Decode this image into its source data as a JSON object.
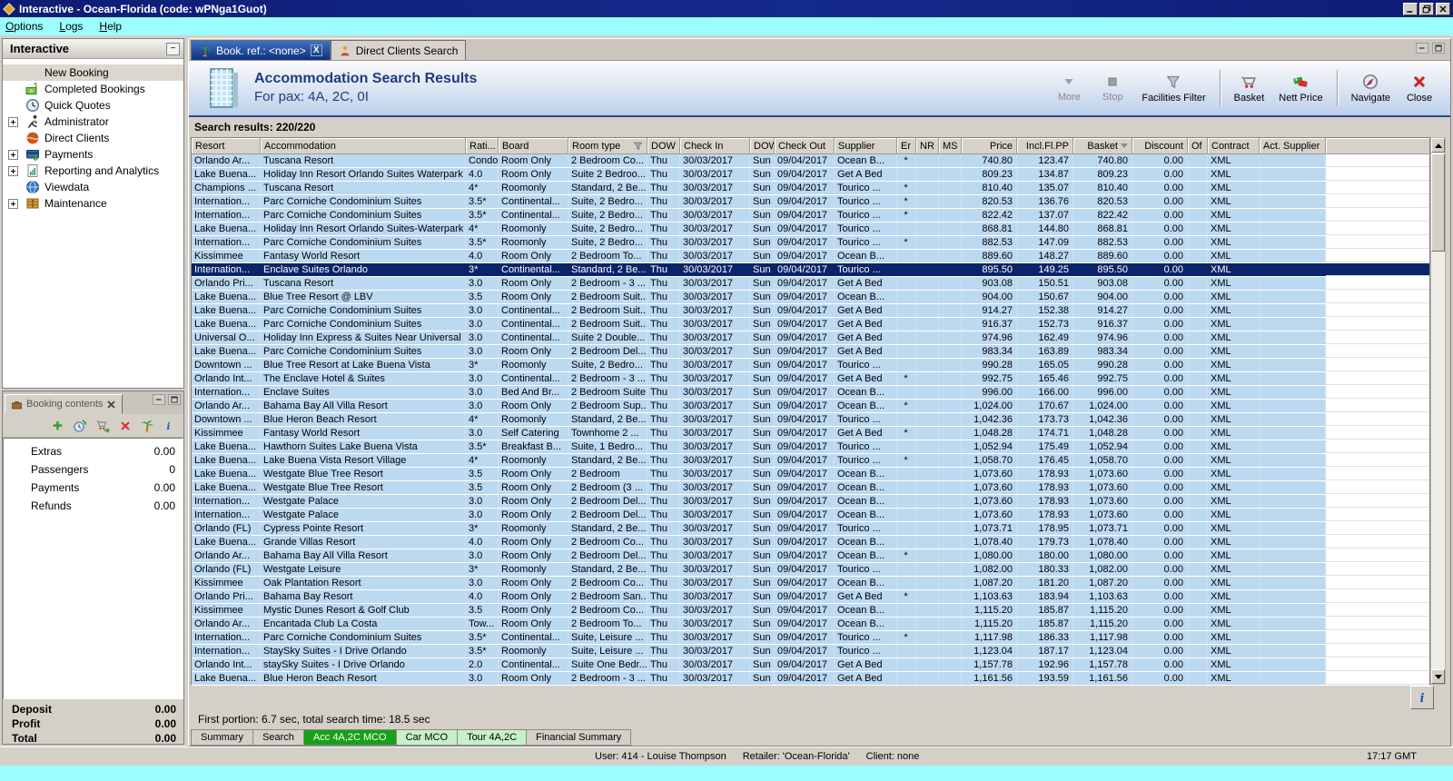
{
  "window": {
    "title": "Interactive - Ocean-Florida (code: wPNga1Guot)"
  },
  "menu": [
    "Options",
    "Logs",
    "Help"
  ],
  "sidebar": {
    "title": "Interactive",
    "items": [
      {
        "label": "New Booking",
        "icon": "palm-tree",
        "expandable": false,
        "selected": true
      },
      {
        "label": "Completed Bookings",
        "icon": "money-palm",
        "expandable": false
      },
      {
        "label": "Quick Quotes",
        "icon": "clock",
        "expandable": false
      },
      {
        "label": "Administrator",
        "icon": "runner",
        "expandable": true
      },
      {
        "label": "Direct Clients",
        "icon": "globe-red",
        "expandable": false
      },
      {
        "label": "Payments",
        "icon": "payments",
        "expandable": true
      },
      {
        "label": "Reporting and Analytics",
        "icon": "report",
        "expandable": true
      },
      {
        "label": "Viewdata",
        "icon": "globe",
        "expandable": false
      },
      {
        "label": "Maintenance",
        "icon": "drawers",
        "expandable": true
      }
    ]
  },
  "booking_contents": {
    "tab_title": "Booking contents",
    "rows": [
      {
        "label": "Extras",
        "value": "0.00"
      },
      {
        "label": "Passengers",
        "value": "0"
      },
      {
        "label": "Payments",
        "value": "0.00"
      },
      {
        "label": "Refunds",
        "value": "0.00"
      }
    ],
    "totals": [
      {
        "label": "Deposit",
        "value": "0.00"
      },
      {
        "label": "Profit",
        "value": "0.00"
      },
      {
        "label": "Total",
        "value": "0.00"
      }
    ]
  },
  "tab_bar": {
    "tabs": [
      {
        "label": "Book. ref.: <none>"
      },
      {
        "label": "Direct Clients Search"
      }
    ]
  },
  "header": {
    "title": "Accommodation Search Results",
    "subtitle": "For pax: 4A, 2C, 0I"
  },
  "toolbar": {
    "buttons": [
      {
        "label": "More",
        "enabled": false
      },
      {
        "label": "Stop",
        "enabled": false
      },
      {
        "label": "Facilities Filter",
        "enabled": true
      },
      {
        "label": "Basket",
        "enabled": true
      },
      {
        "label": "Nett Price",
        "enabled": true
      },
      {
        "label": "Navigate",
        "enabled": true
      },
      {
        "label": "Close",
        "enabled": true
      }
    ]
  },
  "results_label": "Search results: 220/220",
  "table": {
    "selected_index": 8,
    "columns": [
      {
        "label": "Resort"
      },
      {
        "label": "Accommodation"
      },
      {
        "label": "Rati..."
      },
      {
        "label": "Board"
      },
      {
        "label": "Room type",
        "icon": "filter"
      },
      {
        "label": "DOW"
      },
      {
        "label": "Check In"
      },
      {
        "label": "DOW"
      },
      {
        "label": "Check Out"
      },
      {
        "label": "Supplier"
      },
      {
        "label": "Er"
      },
      {
        "label": "NR"
      },
      {
        "label": "MS"
      },
      {
        "label": "Price"
      },
      {
        "label": "Incl.Fl.PP"
      },
      {
        "label": "Basket",
        "sort": "desc"
      },
      {
        "label": "Discount"
      },
      {
        "label": "Of"
      },
      {
        "label": "Contract"
      },
      {
        "label": "Act. Supplier"
      }
    ],
    "rows": [
      [
        "Orlando Ar...",
        "Tuscana Resort",
        "Condo",
        "Room Only",
        "2 Bedroom Co...",
        "Thu",
        "30/03/2017",
        "Sun",
        "09/04/2017",
        "Ocean B...",
        "*",
        "",
        "",
        "740.80",
        "123.47",
        "740.80",
        "0.00",
        "",
        "XML",
        ""
      ],
      [
        "Lake Buena...",
        "Holiday Inn Resort Orlando Suites Waterpark",
        "4.0",
        "Room Only",
        "Suite 2 Bedroo...",
        "Thu",
        "30/03/2017",
        "Sun",
        "09/04/2017",
        "Get A Bed",
        "",
        "",
        "",
        "809.23",
        "134.87",
        "809.23",
        "0.00",
        "",
        "XML",
        ""
      ],
      [
        "Champions ...",
        "Tuscana Resort",
        "4*",
        "Roomonly",
        "Standard, 2 Be...",
        "Thu",
        "30/03/2017",
        "Sun",
        "09/04/2017",
        "Tourico ...",
        "*",
        "",
        "",
        "810.40",
        "135.07",
        "810.40",
        "0.00",
        "",
        "XML",
        ""
      ],
      [
        "Internation...",
        "Parc Corniche Condominium Suites",
        "3.5*",
        "Continental...",
        "Suite, 2 Bedro...",
        "Thu",
        "30/03/2017",
        "Sun",
        "09/04/2017",
        "Tourico ...",
        "*",
        "",
        "",
        "820.53",
        "136.76",
        "820.53",
        "0.00",
        "",
        "XML",
        ""
      ],
      [
        "Internation...",
        "Parc Corniche Condominium Suites",
        "3.5*",
        "Continental...",
        "Suite, 2 Bedro...",
        "Thu",
        "30/03/2017",
        "Sun",
        "09/04/2017",
        "Tourico ...",
        "*",
        "",
        "",
        "822.42",
        "137.07",
        "822.42",
        "0.00",
        "",
        "XML",
        ""
      ],
      [
        "Lake Buena...",
        "Holiday Inn Resort Orlando Suites-Waterpark",
        "4*",
        "Roomonly",
        "Suite, 2 Bedro...",
        "Thu",
        "30/03/2017",
        "Sun",
        "09/04/2017",
        "Tourico ...",
        "",
        "",
        "",
        "868.81",
        "144.80",
        "868.81",
        "0.00",
        "",
        "XML",
        ""
      ],
      [
        "Internation...",
        "Parc Corniche Condominium Suites",
        "3.5*",
        "Roomonly",
        "Suite, 2 Bedro...",
        "Thu",
        "30/03/2017",
        "Sun",
        "09/04/2017",
        "Tourico ...",
        "*",
        "",
        "",
        "882.53",
        "147.09",
        "882.53",
        "0.00",
        "",
        "XML",
        ""
      ],
      [
        "Kissimmee",
        "Fantasy World Resort",
        "4.0",
        "Room Only",
        "2 Bedroom To...",
        "Thu",
        "30/03/2017",
        "Sun",
        "09/04/2017",
        "Ocean B...",
        "",
        "",
        "",
        "889.60",
        "148.27",
        "889.60",
        "0.00",
        "",
        "XML",
        ""
      ],
      [
        "Internation...",
        "Enclave Suites Orlando",
        "3*",
        "Continental...",
        "Standard, 2 Be...",
        "Thu",
        "30/03/2017",
        "Sun",
        "09/04/2017",
        "Tourico ...",
        "",
        "",
        "",
        "895.50",
        "149.25",
        "895.50",
        "0.00",
        "",
        "XML",
        ""
      ],
      [
        "Orlando Pri...",
        "Tuscana Resort",
        "3.0",
        "Room Only",
        "2 Bedroom - 3 ...",
        "Thu",
        "30/03/2017",
        "Sun",
        "09/04/2017",
        "Get A Bed",
        "",
        "",
        "",
        "903.08",
        "150.51",
        "903.08",
        "0.00",
        "",
        "XML",
        ""
      ],
      [
        "Lake Buena...",
        "Blue Tree Resort @ LBV",
        "3.5",
        "Room Only",
        "2 Bedroom Suit...",
        "Thu",
        "30/03/2017",
        "Sun",
        "09/04/2017",
        "Ocean B...",
        "",
        "",
        "",
        "904.00",
        "150.67",
        "904.00",
        "0.00",
        "",
        "XML",
        ""
      ],
      [
        "Lake Buena...",
        "Parc Corniche Condominium Suites",
        "3.0",
        "Continental...",
        "2 Bedroom Suit...",
        "Thu",
        "30/03/2017",
        "Sun",
        "09/04/2017",
        "Get A Bed",
        "",
        "",
        "",
        "914.27",
        "152.38",
        "914.27",
        "0.00",
        "",
        "XML",
        ""
      ],
      [
        "Lake Buena...",
        "Parc Corniche Condominium Suites",
        "3.0",
        "Continental...",
        "2 Bedroom Suit...",
        "Thu",
        "30/03/2017",
        "Sun",
        "09/04/2017",
        "Get A Bed",
        "",
        "",
        "",
        "916.37",
        "152.73",
        "916.37",
        "0.00",
        "",
        "XML",
        ""
      ],
      [
        "Universal O...",
        "Holiday Inn Express & Suites Near Universal",
        "3.0",
        "Continental...",
        "Suite 2 Double...",
        "Thu",
        "30/03/2017",
        "Sun",
        "09/04/2017",
        "Get A Bed",
        "",
        "",
        "",
        "974.96",
        "162.49",
        "974.96",
        "0.00",
        "",
        "XML",
        ""
      ],
      [
        "Lake Buena...",
        "Parc Corniche Condominium Suites",
        "3.0",
        "Room Only",
        "2 Bedroom Del...",
        "Thu",
        "30/03/2017",
        "Sun",
        "09/04/2017",
        "Get A Bed",
        "",
        "",
        "",
        "983.34",
        "163.89",
        "983.34",
        "0.00",
        "",
        "XML",
        ""
      ],
      [
        "Downtown ...",
        "Blue Tree Resort at Lake Buena Vista",
        "3*",
        "Roomonly",
        "Suite, 2 Bedro...",
        "Thu",
        "30/03/2017",
        "Sun",
        "09/04/2017",
        "Tourico ...",
        "",
        "",
        "",
        "990.28",
        "165.05",
        "990.28",
        "0.00",
        "",
        "XML",
        ""
      ],
      [
        "Orlando Int...",
        "The Enclave Hotel & Suites",
        "3.0",
        "Continental...",
        "2 Bedroom - 3 ...",
        "Thu",
        "30/03/2017",
        "Sun",
        "09/04/2017",
        "Get A Bed",
        "*",
        "",
        "",
        "992.75",
        "165.46",
        "992.75",
        "0.00",
        "",
        "XML",
        ""
      ],
      [
        "Internation...",
        "Enclave Suites",
        "3.0",
        "Bed And Br...",
        "2 Bedroom Suite",
        "Thu",
        "30/03/2017",
        "Sun",
        "09/04/2017",
        "Ocean B...",
        "",
        "",
        "",
        "996.00",
        "166.00",
        "996.00",
        "0.00",
        "",
        "XML",
        ""
      ],
      [
        "Orlando Ar...",
        "Bahama Bay All Villa Resort",
        "3.0",
        "Room Only",
        "2 Bedroom Sup...",
        "Thu",
        "30/03/2017",
        "Sun",
        "09/04/2017",
        "Ocean B...",
        "*",
        "",
        "",
        "1,024.00",
        "170.67",
        "1,024.00",
        "0.00",
        "",
        "XML",
        ""
      ],
      [
        "Downtown ...",
        "Blue Heron Beach Resort",
        "4*",
        "Roomonly",
        "Standard, 2 Be...",
        "Thu",
        "30/03/2017",
        "Sun",
        "09/04/2017",
        "Tourico ...",
        "",
        "",
        "",
        "1,042.36",
        "173.73",
        "1,042.36",
        "0.00",
        "",
        "XML",
        ""
      ],
      [
        "Kissimmee",
        "Fantasy World Resort",
        "3.0",
        "Self Catering",
        "Townhome 2 ...",
        "Thu",
        "30/03/2017",
        "Sun",
        "09/04/2017",
        "Get A Bed",
        "*",
        "",
        "",
        "1,048.28",
        "174.71",
        "1,048.28",
        "0.00",
        "",
        "XML",
        ""
      ],
      [
        "Lake Buena...",
        "Hawthorn Suites Lake Buena Vista",
        "3.5*",
        "Breakfast B...",
        "Suite, 1 Bedro...",
        "Thu",
        "30/03/2017",
        "Sun",
        "09/04/2017",
        "Tourico ...",
        "",
        "",
        "",
        "1,052.94",
        "175.49",
        "1,052.94",
        "0.00",
        "",
        "XML",
        ""
      ],
      [
        "Lake Buena...",
        "Lake Buena Vista Resort Village",
        "4*",
        "Roomonly",
        "Standard, 2 Be...",
        "Thu",
        "30/03/2017",
        "Sun",
        "09/04/2017",
        "Tourico ...",
        "*",
        "",
        "",
        "1,058.70",
        "176.45",
        "1,058.70",
        "0.00",
        "",
        "XML",
        ""
      ],
      [
        "Lake Buena...",
        "Westgate Blue Tree Resort",
        "3.5",
        "Room Only",
        "2 Bedroom",
        "Thu",
        "30/03/2017",
        "Sun",
        "09/04/2017",
        "Ocean B...",
        "",
        "",
        "",
        "1,073.60",
        "178.93",
        "1,073.60",
        "0.00",
        "",
        "XML",
        ""
      ],
      [
        "Lake Buena...",
        "Westgate Blue Tree Resort",
        "3.5",
        "Room Only",
        "2 Bedroom (3 ...",
        "Thu",
        "30/03/2017",
        "Sun",
        "09/04/2017",
        "Ocean B...",
        "",
        "",
        "",
        "1,073.60",
        "178.93",
        "1,073.60",
        "0.00",
        "",
        "XML",
        ""
      ],
      [
        "Internation...",
        "Westgate Palace",
        "3.0",
        "Room Only",
        "2 Bedroom Del...",
        "Thu",
        "30/03/2017",
        "Sun",
        "09/04/2017",
        "Ocean B...",
        "",
        "",
        "",
        "1,073.60",
        "178.93",
        "1,073.60",
        "0.00",
        "",
        "XML",
        ""
      ],
      [
        "Internation...",
        "Westgate Palace",
        "3.0",
        "Room Only",
        "2 Bedroom Del...",
        "Thu",
        "30/03/2017",
        "Sun",
        "09/04/2017",
        "Ocean B...",
        "",
        "",
        "",
        "1,073.60",
        "178.93",
        "1,073.60",
        "0.00",
        "",
        "XML",
        ""
      ],
      [
        "Orlando (FL)",
        "Cypress Pointe Resort",
        "3*",
        "Roomonly",
        "Standard, 2 Be...",
        "Thu",
        "30/03/2017",
        "Sun",
        "09/04/2017",
        "Tourico ...",
        "",
        "",
        "",
        "1,073.71",
        "178.95",
        "1,073.71",
        "0.00",
        "",
        "XML",
        ""
      ],
      [
        "Lake Buena...",
        "Grande Villas Resort",
        "4.0",
        "Room Only",
        "2 Bedroom Co...",
        "Thu",
        "30/03/2017",
        "Sun",
        "09/04/2017",
        "Ocean B...",
        "",
        "",
        "",
        "1,078.40",
        "179.73",
        "1,078.40",
        "0.00",
        "",
        "XML",
        ""
      ],
      [
        "Orlando Ar...",
        "Bahama Bay All Villa Resort",
        "3.0",
        "Room Only",
        "2 Bedroom Del...",
        "Thu",
        "30/03/2017",
        "Sun",
        "09/04/2017",
        "Ocean B...",
        "*",
        "",
        "",
        "1,080.00",
        "180.00",
        "1,080.00",
        "0.00",
        "",
        "XML",
        ""
      ],
      [
        "Orlando (FL)",
        "Westgate Leisure",
        "3*",
        "Roomonly",
        "Standard, 2 Be...",
        "Thu",
        "30/03/2017",
        "Sun",
        "09/04/2017",
        "Tourico ...",
        "",
        "",
        "",
        "1,082.00",
        "180.33",
        "1,082.00",
        "0.00",
        "",
        "XML",
        ""
      ],
      [
        "Kissimmee",
        "Oak Plantation Resort",
        "3.0",
        "Room Only",
        "2 Bedroom Co...",
        "Thu",
        "30/03/2017",
        "Sun",
        "09/04/2017",
        "Ocean B...",
        "",
        "",
        "",
        "1,087.20",
        "181.20",
        "1,087.20",
        "0.00",
        "",
        "XML",
        ""
      ],
      [
        "Orlando Pri...",
        "Bahama Bay Resort",
        "4.0",
        "Room Only",
        "2 Bedroom San...",
        "Thu",
        "30/03/2017",
        "Sun",
        "09/04/2017",
        "Get A Bed",
        "*",
        "",
        "",
        "1,103.63",
        "183.94",
        "1,103.63",
        "0.00",
        "",
        "XML",
        ""
      ],
      [
        "Kissimmee",
        "Mystic Dunes Resort & Golf Club",
        "3.5",
        "Room Only",
        "2 Bedroom Co...",
        "Thu",
        "30/03/2017",
        "Sun",
        "09/04/2017",
        "Ocean B...",
        "",
        "",
        "",
        "1,115.20",
        "185.87",
        "1,115.20",
        "0.00",
        "",
        "XML",
        ""
      ],
      [
        "Orlando Ar...",
        "Encantada Club La Costa",
        "Tow...",
        "Room Only",
        "2 Bedroom To...",
        "Thu",
        "30/03/2017",
        "Sun",
        "09/04/2017",
        "Ocean B...",
        "",
        "",
        "",
        "1,115.20",
        "185.87",
        "1,115.20",
        "0.00",
        "",
        "XML",
        ""
      ],
      [
        "Internation...",
        "Parc Corniche Condominium Suites",
        "3.5*",
        "Continental...",
        "Suite, Leisure ...",
        "Thu",
        "30/03/2017",
        "Sun",
        "09/04/2017",
        "Tourico ...",
        "*",
        "",
        "",
        "1,117.98",
        "186.33",
        "1,117.98",
        "0.00",
        "",
        "XML",
        ""
      ],
      [
        "Internation...",
        "StaySky Suites - I Drive Orlando",
        "3.5*",
        "Roomonly",
        "Suite, Leisure ...",
        "Thu",
        "30/03/2017",
        "Sun",
        "09/04/2017",
        "Tourico ...",
        "",
        "",
        "",
        "1,123.04",
        "187.17",
        "1,123.04",
        "0.00",
        "",
        "XML",
        ""
      ],
      [
        "Orlando Int...",
        "staySky Suites - I Drive Orlando",
        "2.0",
        "Continental...",
        "Suite One Bedr...",
        "Thu",
        "30/03/2017",
        "Sun",
        "09/04/2017",
        "Get A Bed",
        "",
        "",
        "",
        "1,157.78",
        "192.96",
        "1,157.78",
        "0.00",
        "",
        "XML",
        ""
      ],
      [
        "Lake Buena...",
        "Blue Heron Beach Resort",
        "3.0",
        "Room Only",
        "2 Bedroom - 3 ...",
        "Thu",
        "30/03/2017",
        "Sun",
        "09/04/2017",
        "Get A Bed",
        "",
        "",
        "",
        "1,161.56",
        "193.59",
        "1,161.56",
        "0.00",
        "",
        "XML",
        ""
      ]
    ]
  },
  "footer": {
    "status": "First portion: 6.7 sec, total search time: 18.5 sec",
    "tabs": [
      {
        "label": "Summary",
        "variant": "plain"
      },
      {
        "label": "Search",
        "variant": "plain"
      },
      {
        "label": "Acc 4A,2C MCO",
        "variant": "active"
      },
      {
        "label": "Car MCO",
        "variant": "pale"
      },
      {
        "label": "Tour 4A,2C",
        "variant": "pale"
      },
      {
        "label": "Financial Summary",
        "variant": "plain"
      }
    ]
  },
  "statusbar": {
    "user": "User: 414 - Louise Thompson",
    "retailer": "Retailer: 'Ocean-Florida'",
    "client": "Client: none",
    "time": "17:17 GMT"
  },
  "colors": {
    "accent_navy": "#0a246a",
    "row_blue": "#bcd9f2",
    "active_tab_green": "#18a018",
    "pale_tab_green": "#c9efc9",
    "menubar_cyan": "#9bfdff"
  }
}
